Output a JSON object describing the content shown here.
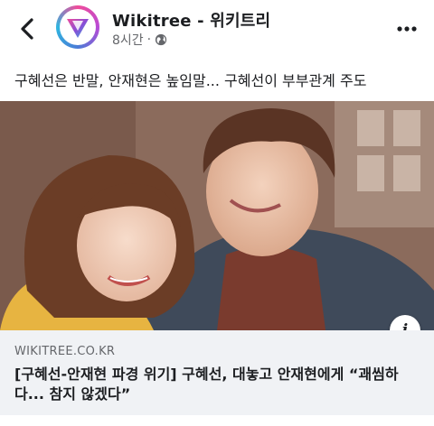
{
  "header": {
    "page_name": "Wikitree - 위키트리",
    "time": "8시간",
    "separator": "·",
    "privacy_icon": "globe-icon",
    "back_icon": "chevron-left-icon",
    "more_icon": "more-icon"
  },
  "post": {
    "text": "구혜선은 반말, 안재현은 높임말... 구혜선이 부부관계 주도"
  },
  "link": {
    "domain": "WIKITREE.CO.KR",
    "headline": "[구혜선-안재현 파경 위기] 구혜선, 대놓고 안재현에게 “괘씸하다... 참지 않겠다”",
    "info_icon": "info-icon",
    "info_glyph": "i"
  },
  "colors": {
    "accent_gradient": [
      "#f04b9a",
      "#b84bd6",
      "#4b7bd6",
      "#2fb6e0"
    ],
    "link_card_bg": "#f0f2f5",
    "muted_text": "#65676b"
  }
}
